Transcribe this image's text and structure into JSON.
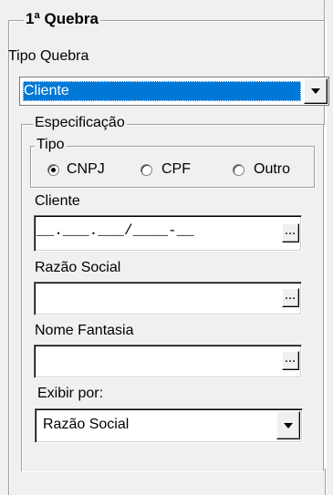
{
  "section": {
    "title": "1ª Quebra"
  },
  "tipo_quebra": {
    "label": "Tipo Quebra",
    "value": "Cliente",
    "icon": "chevron-down-icon"
  },
  "especificacao": {
    "title": "Especificação",
    "tipo": {
      "title": "Tipo",
      "options": [
        "CNPJ",
        "CPF",
        "Outro"
      ],
      "selected": "CNPJ"
    },
    "cliente": {
      "label": "Cliente",
      "mask": "__.___.___/____-__",
      "button": "..."
    },
    "razao_social": {
      "label": "Razão Social",
      "value": "",
      "button": "..."
    },
    "nome_fantasia": {
      "label": "Nome Fantasia",
      "value": "",
      "button": "..."
    },
    "exibir_por": {
      "label": "Exibir por:",
      "value": "Razão Social",
      "icon": "chevron-down-icon"
    }
  },
  "colors": {
    "selection": "#0078d7",
    "window": "#f0f0f0"
  }
}
